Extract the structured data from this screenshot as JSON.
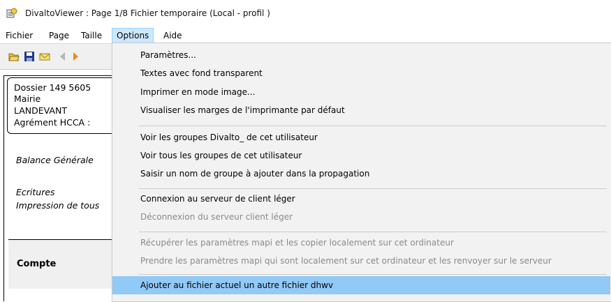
{
  "window": {
    "title": "DivaltoViewer : Page 1/8 Fichier temporaire  (Local - profil )"
  },
  "menubar": {
    "items": [
      "Fichier",
      "Page",
      "Taille",
      "Options",
      "Aide"
    ]
  },
  "toolbar": {
    "icons": [
      "open-folder-icon",
      "save-icon",
      "email-icon",
      "previous-page-icon",
      "next-page-icon"
    ]
  },
  "document": {
    "address_lines": [
      "Dossier 149    5605",
      "Mairie",
      "LANDEVANT",
      "Agrément HCCA :"
    ],
    "balance_text": "Balance  Générale",
    "ecritures_text": "Ecritures",
    "impression_text": "Impression de tous",
    "column_compte": "Compte"
  },
  "options_menu": {
    "groups": [
      [
        {
          "label": "Paramètres...",
          "enabled": true
        },
        {
          "label": "Textes avec fond transparent",
          "enabled": true
        },
        {
          "label": "Imprimer en mode image...",
          "enabled": true
        },
        {
          "label": "Visualiser les marges de l'imprimante par défaut",
          "enabled": true
        }
      ],
      [
        {
          "label": "Voir les groupes Divalto_ de cet utilisateur",
          "enabled": true
        },
        {
          "label": "Voir tous les groupes de cet utilisateur",
          "enabled": true
        },
        {
          "label": "Saisir un nom de groupe à ajouter dans la propagation",
          "enabled": true
        }
      ],
      [
        {
          "label": "Connexion au serveur de client léger",
          "enabled": true
        },
        {
          "label": "Déconnexion du serveur client léger",
          "enabled": false
        }
      ],
      [
        {
          "label": "Récupérer les paramètres mapi et les copier localement sur cet ordinateur",
          "enabled": false
        },
        {
          "label": "Prendre les paramètres mapi qui sont localement sur cet ordinateur et les renvoyer sur le serveur",
          "enabled": false
        }
      ],
      [
        {
          "label": "Ajouter au fichier actuel un autre fichier dhwv",
          "enabled": true,
          "highlighted": true
        }
      ]
    ]
  },
  "colors": {
    "menu_highlight": "#91c9f7",
    "menubar_active": "#cce8ff",
    "disabled_text": "#8a8a8a"
  }
}
